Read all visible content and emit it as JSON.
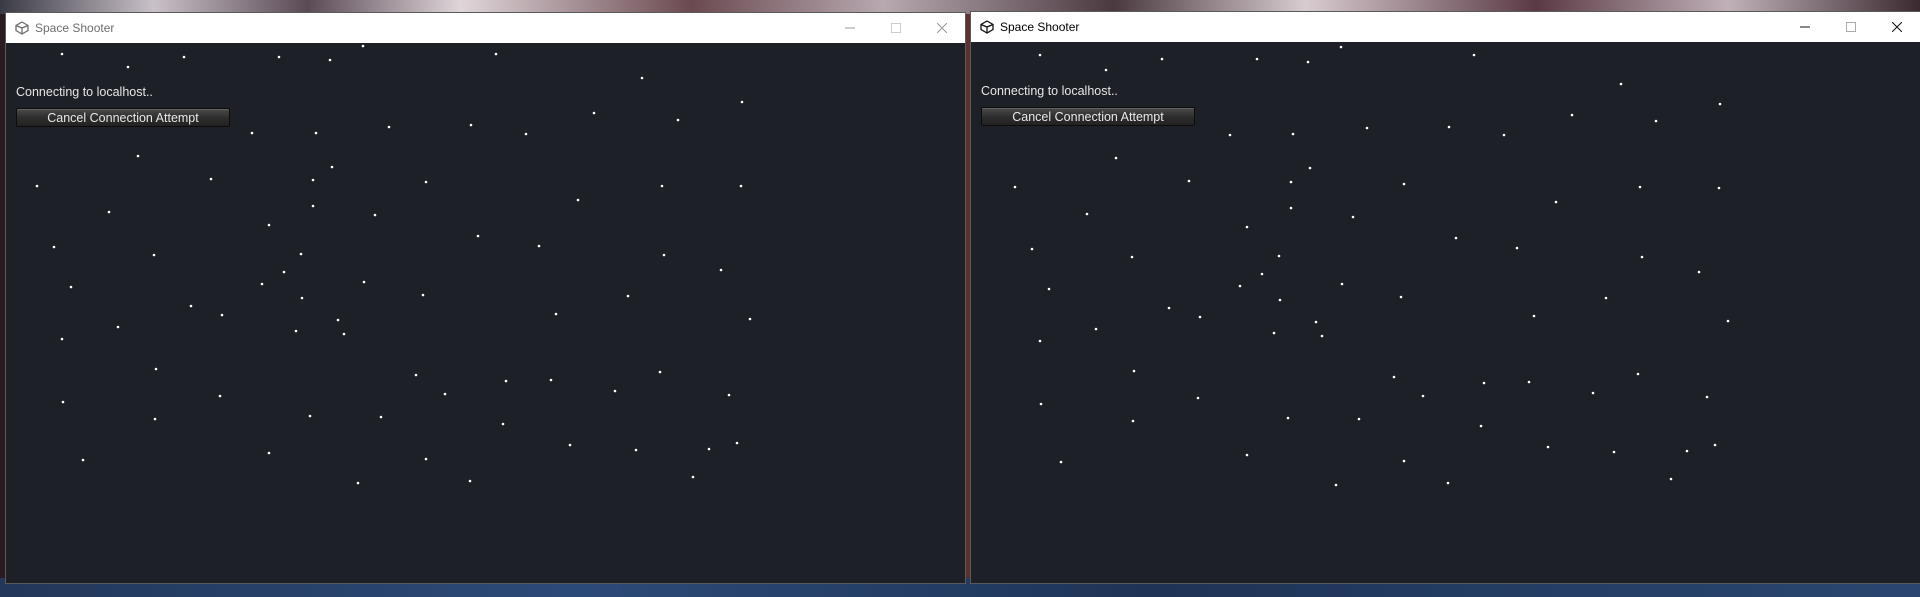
{
  "windows": [
    {
      "title": "Space Shooter",
      "icon": "unity-logo-icon",
      "state": "inactive",
      "status_text": "Connecting to localhost..",
      "cancel_label": "Cancel Connection Attempt"
    },
    {
      "title": "Space Shooter",
      "icon": "unity-logo-icon",
      "state": "active",
      "status_text": "Connecting to localhost..",
      "cancel_label": "Cancel Connection Attempt"
    }
  ],
  "caption_buttons": [
    "minimize-icon",
    "maximize-icon",
    "close-icon"
  ],
  "colors": {
    "game_background": "#1d2027",
    "star": "#ffffff",
    "titlebar": "#ffffff"
  }
}
